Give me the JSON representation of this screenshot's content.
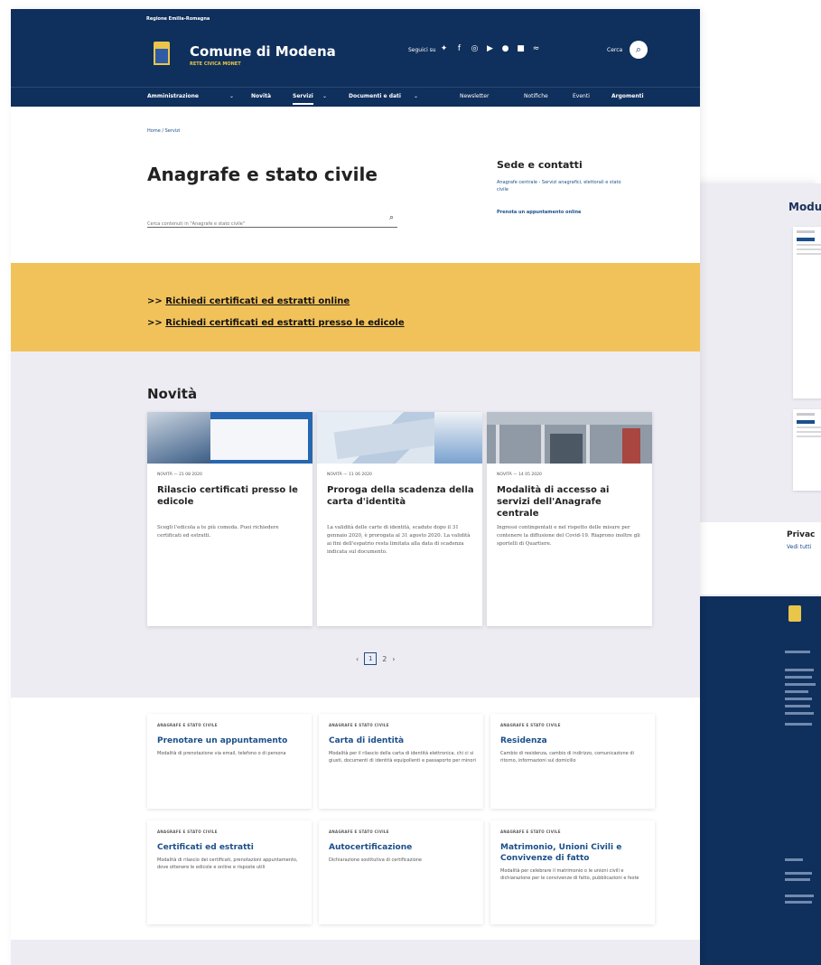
{
  "top_bar": {
    "region": "Regione Emilia-Romagna"
  },
  "header": {
    "title": "Comune di Modena",
    "subtitle": "RETE CIVICA MONET",
    "follow_label": "Seguici su",
    "search_label": "Cerca",
    "socials": [
      "twitter-icon",
      "facebook-icon",
      "instagram-icon",
      "youtube-icon",
      "telegram-icon",
      "flickr-icon",
      "rss-icon"
    ]
  },
  "nav": {
    "items": [
      "Amministrazione",
      "Novità",
      "Servizi",
      "Documenti e dati",
      "Newsletter",
      "Notifiche",
      "Eventi",
      "Argomenti"
    ]
  },
  "breadcrumb": "Home / Servizi",
  "page": {
    "title": "Anagrafe e stato civile",
    "search_placeholder": "Cerca contenuti in \"Anagrafe e stato civile\""
  },
  "sede": {
    "title": "Sede e contatti",
    "text": "Anagrafe centrale - Servizi anagrafici, elettorali e stato civile",
    "link": "Prenota un appuntamento online"
  },
  "banner": {
    "links": [
      {
        "prefix": ">> ",
        "label": "Richiedi certificati ed estratti online"
      },
      {
        "prefix": ">> ",
        "label": "Richiedi certificati ed estratti presso le edicole"
      }
    ]
  },
  "news": {
    "title": "Novità",
    "cards": [
      {
        "meta": "NOVITÀ — 21 08 2020",
        "title": "Rilascio certificati presso le edicole",
        "text": "Scegli l'edicola a te più comoda. Puoi richiedere certificati ed estratti."
      },
      {
        "meta": "NOVITÀ — 11 06 2020",
        "title": "Proroga della scadenza della carta d'identità",
        "text": "La validità delle carte di identità, scadute dopo il 31 gennaio 2020, è prorogata al 31 agosto 2020. La validità ai fini dell'espatrio resta limitata alla data di scadenza indicata sul documento."
      },
      {
        "meta": "NOVITÀ — 14 05 2020",
        "title": "Modalità di accesso ai servizi dell'Anagrafe centrale",
        "text": "Ingressi contingentati e nel rispetto delle misure per contenere la diffusione del Covid-19. Riaprono inoltre gli sportelli di Quartiere."
      }
    ],
    "pages": [
      "1",
      "2"
    ]
  },
  "services": [
    {
      "category": "ANAGRAFE E STATO CIVILE",
      "title": "Prenotare un appuntamento",
      "text": "Modalità di prenotazione via email, telefono o di persona"
    },
    {
      "category": "ANAGRAFE E STATO CIVILE",
      "title": "Carta di identità",
      "text": "Modalità per il rilascio della carta di identità elettronica, chi ci si giusti, documenti di identità equipollenti e passaporto per minori"
    },
    {
      "category": "ANAGRAFE E STATO CIVILE",
      "title": "Residenza",
      "text": "Cambio di residenza, cambio di indirizzo, comunicazione di ritorno, informazioni sul domicilio"
    },
    {
      "category": "ANAGRAFE E STATO CIVILE",
      "title": "Certificati ed estratti",
      "text": "Modalità di rilascio dei certificati, prenotazioni appuntamento, dove ottenere le edicole e online e risposte utili"
    },
    {
      "category": "ANAGRAFE E STATO CIVILE",
      "title": "Autocertificazione",
      "text": "Dichiarazione sostitutiva di certificazione"
    },
    {
      "category": "ANAGRAFE E STATO CIVILE",
      "title": "Matrimonio, Unioni Civili e Convivenze di fatto",
      "text": "Modalità per celebrare il matrimonio o le unioni civili e dichiarazione per le convivenze di fatto, pubblicazioni e feste"
    }
  ],
  "back_page": {
    "section_title": "Modu",
    "privacy_title": "Privac",
    "privacy_link": "Vedi tutti"
  },
  "colors": {
    "navy": "#0f2f5c",
    "gold": "#f2c25a",
    "lavender": "#eeecf3",
    "link": "#1b4f8a"
  }
}
